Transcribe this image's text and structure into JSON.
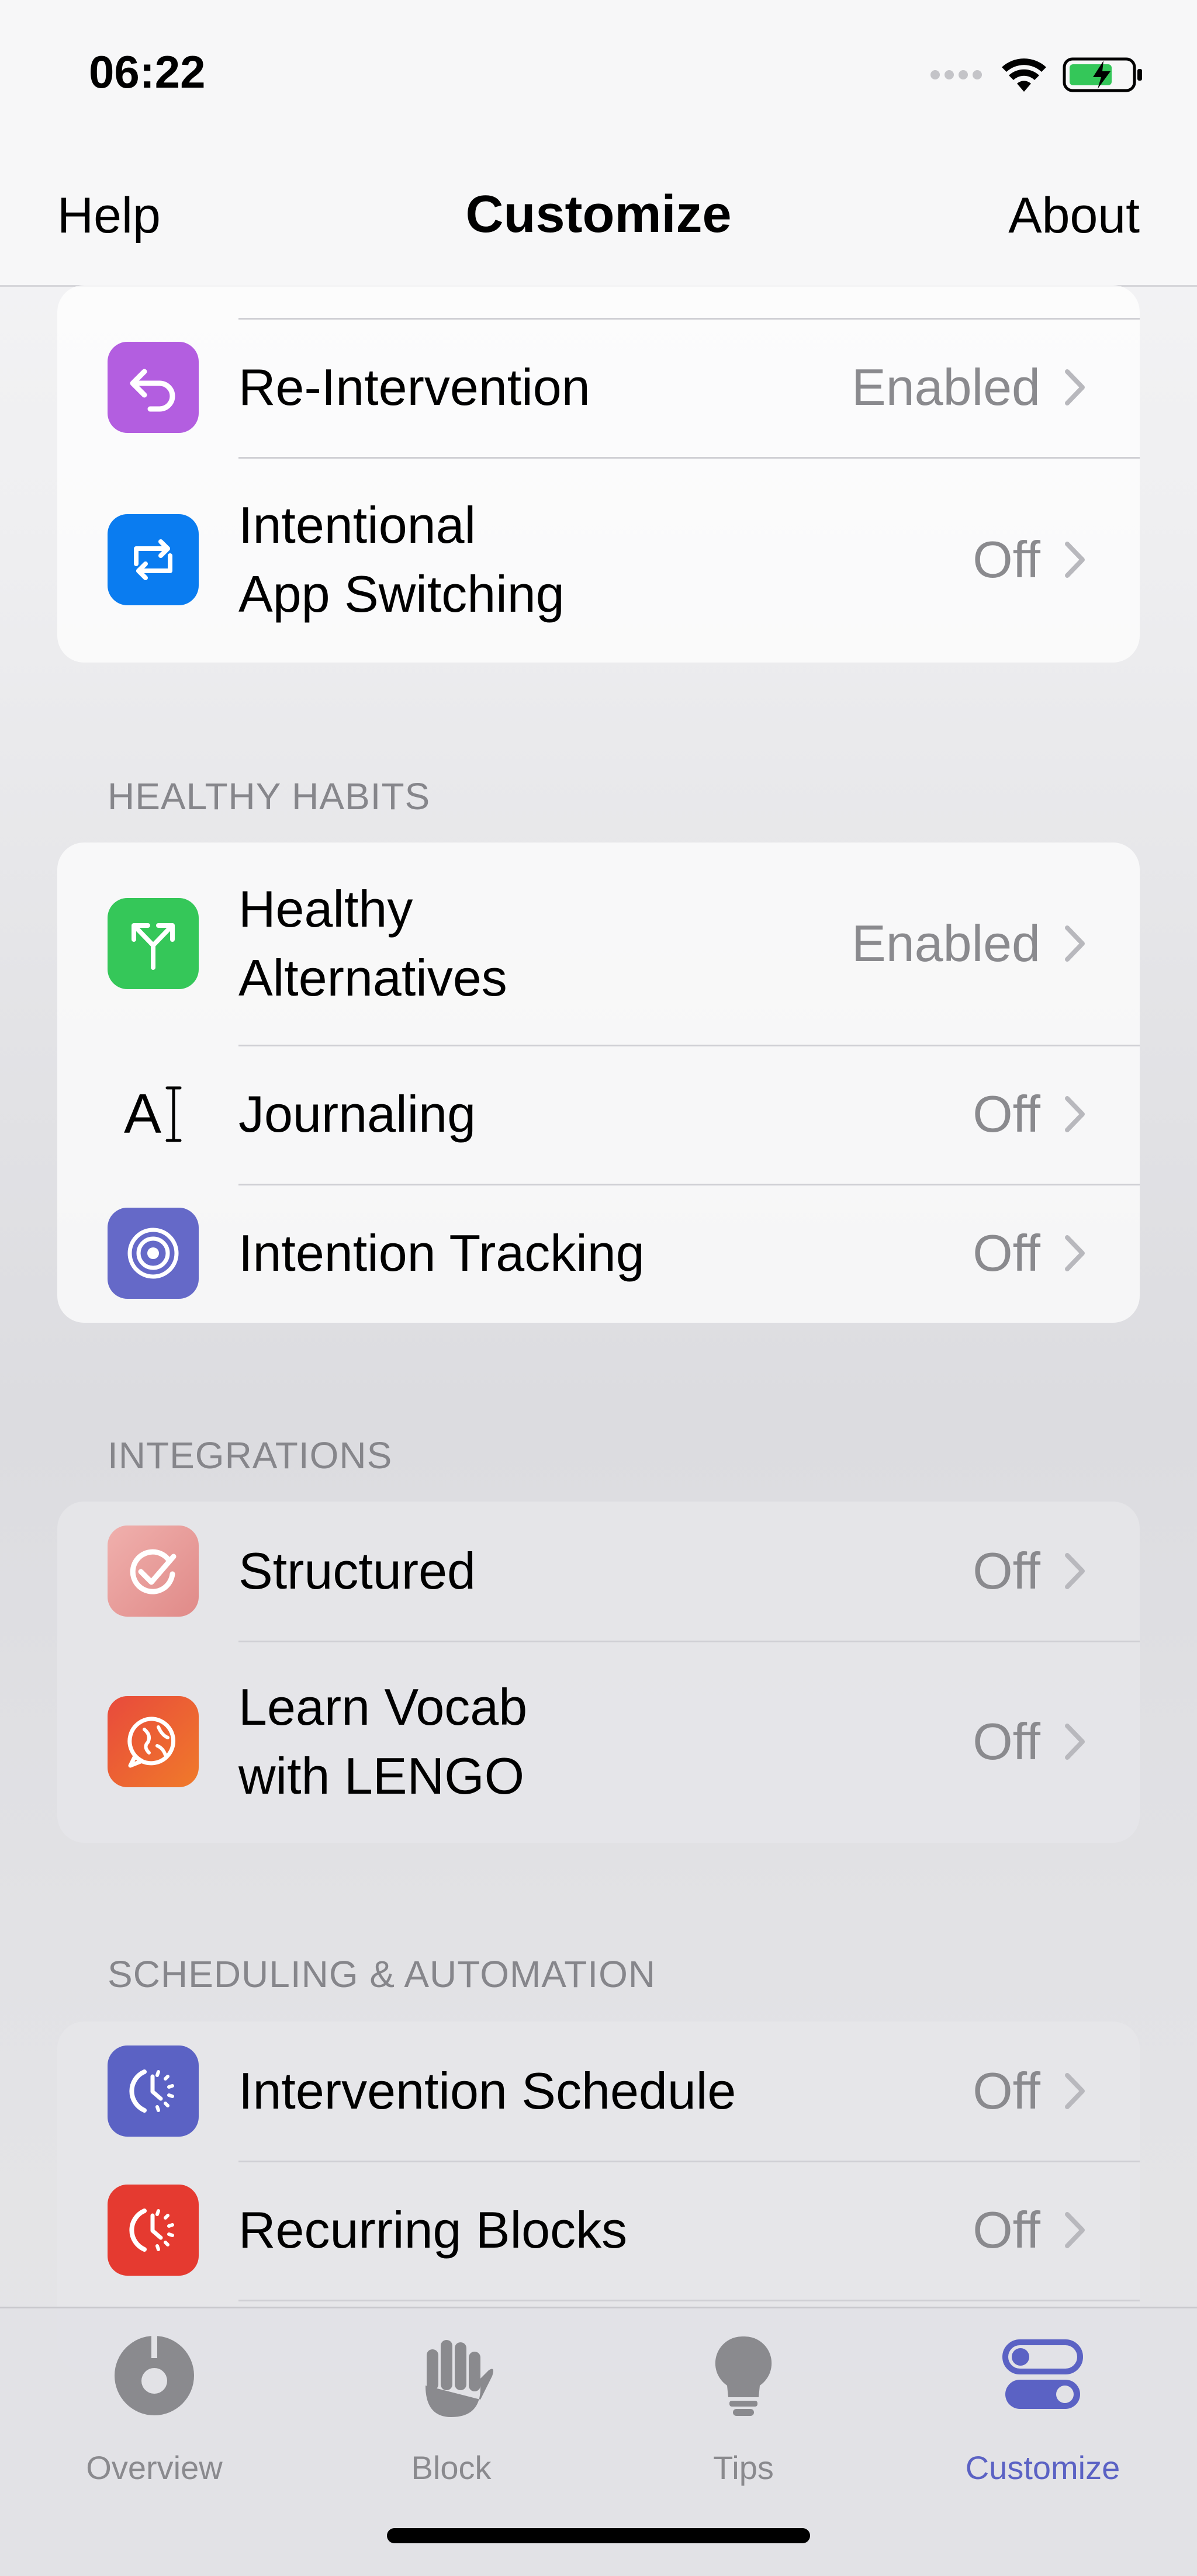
{
  "status": {
    "time": "06:22"
  },
  "nav": {
    "left": "Help",
    "title": "Customize",
    "right": "About"
  },
  "sections": {
    "top": {
      "items": [
        {
          "label": "Re-Intervention",
          "value": "Enabled",
          "icon": "re-intervention-icon",
          "color": "#b35ee0"
        },
        {
          "label_line1": "Intentional",
          "label_line2": "App Switching",
          "value": "Off",
          "icon": "app-switch-icon",
          "color": "#0a7cf0"
        }
      ]
    },
    "healthy": {
      "header": "HEALTHY HABITS",
      "items": [
        {
          "label_line1": "Healthy",
          "label_line2": "Alternatives",
          "value": "Enabled",
          "icon": "fork-arrow-icon",
          "color": "#35c759"
        },
        {
          "label": "Journaling",
          "value": "Off",
          "icon": "text-cursor-icon",
          "icon_text": "A"
        },
        {
          "label": "Intention Tracking",
          "value": "Off",
          "icon": "target-icon",
          "color": "#6569c8"
        }
      ]
    },
    "integrations": {
      "header": "INTEGRATIONS",
      "items": [
        {
          "label": "Structured",
          "value": "Off",
          "icon": "structured-check-icon",
          "color": "#e69a9a"
        },
        {
          "label_line1": "Learn Vocab",
          "label_line2": "with LENGO",
          "value": "Off",
          "icon": "globe-chat-icon",
          "color": "#e8453c"
        }
      ]
    },
    "scheduling": {
      "header": "SCHEDULING & AUTOMATION",
      "items": [
        {
          "label": "Intervention Schedule",
          "value": "Off",
          "icon": "schedule-icon",
          "color": "#5b62c4"
        },
        {
          "label": "Recurring Blocks",
          "value": "Off",
          "icon": "recurring-icon",
          "color": "#e53a30"
        }
      ]
    }
  },
  "tabs": [
    {
      "label": "Overview",
      "icon": "overview-icon"
    },
    {
      "label": "Block",
      "icon": "hand-icon"
    },
    {
      "label": "Tips",
      "icon": "lightbulb-icon"
    },
    {
      "label": "Customize",
      "icon": "toggles-icon",
      "active": true
    }
  ],
  "colors": {
    "accent": "#5b62c4",
    "secondary_text": "#8a8a8e"
  }
}
